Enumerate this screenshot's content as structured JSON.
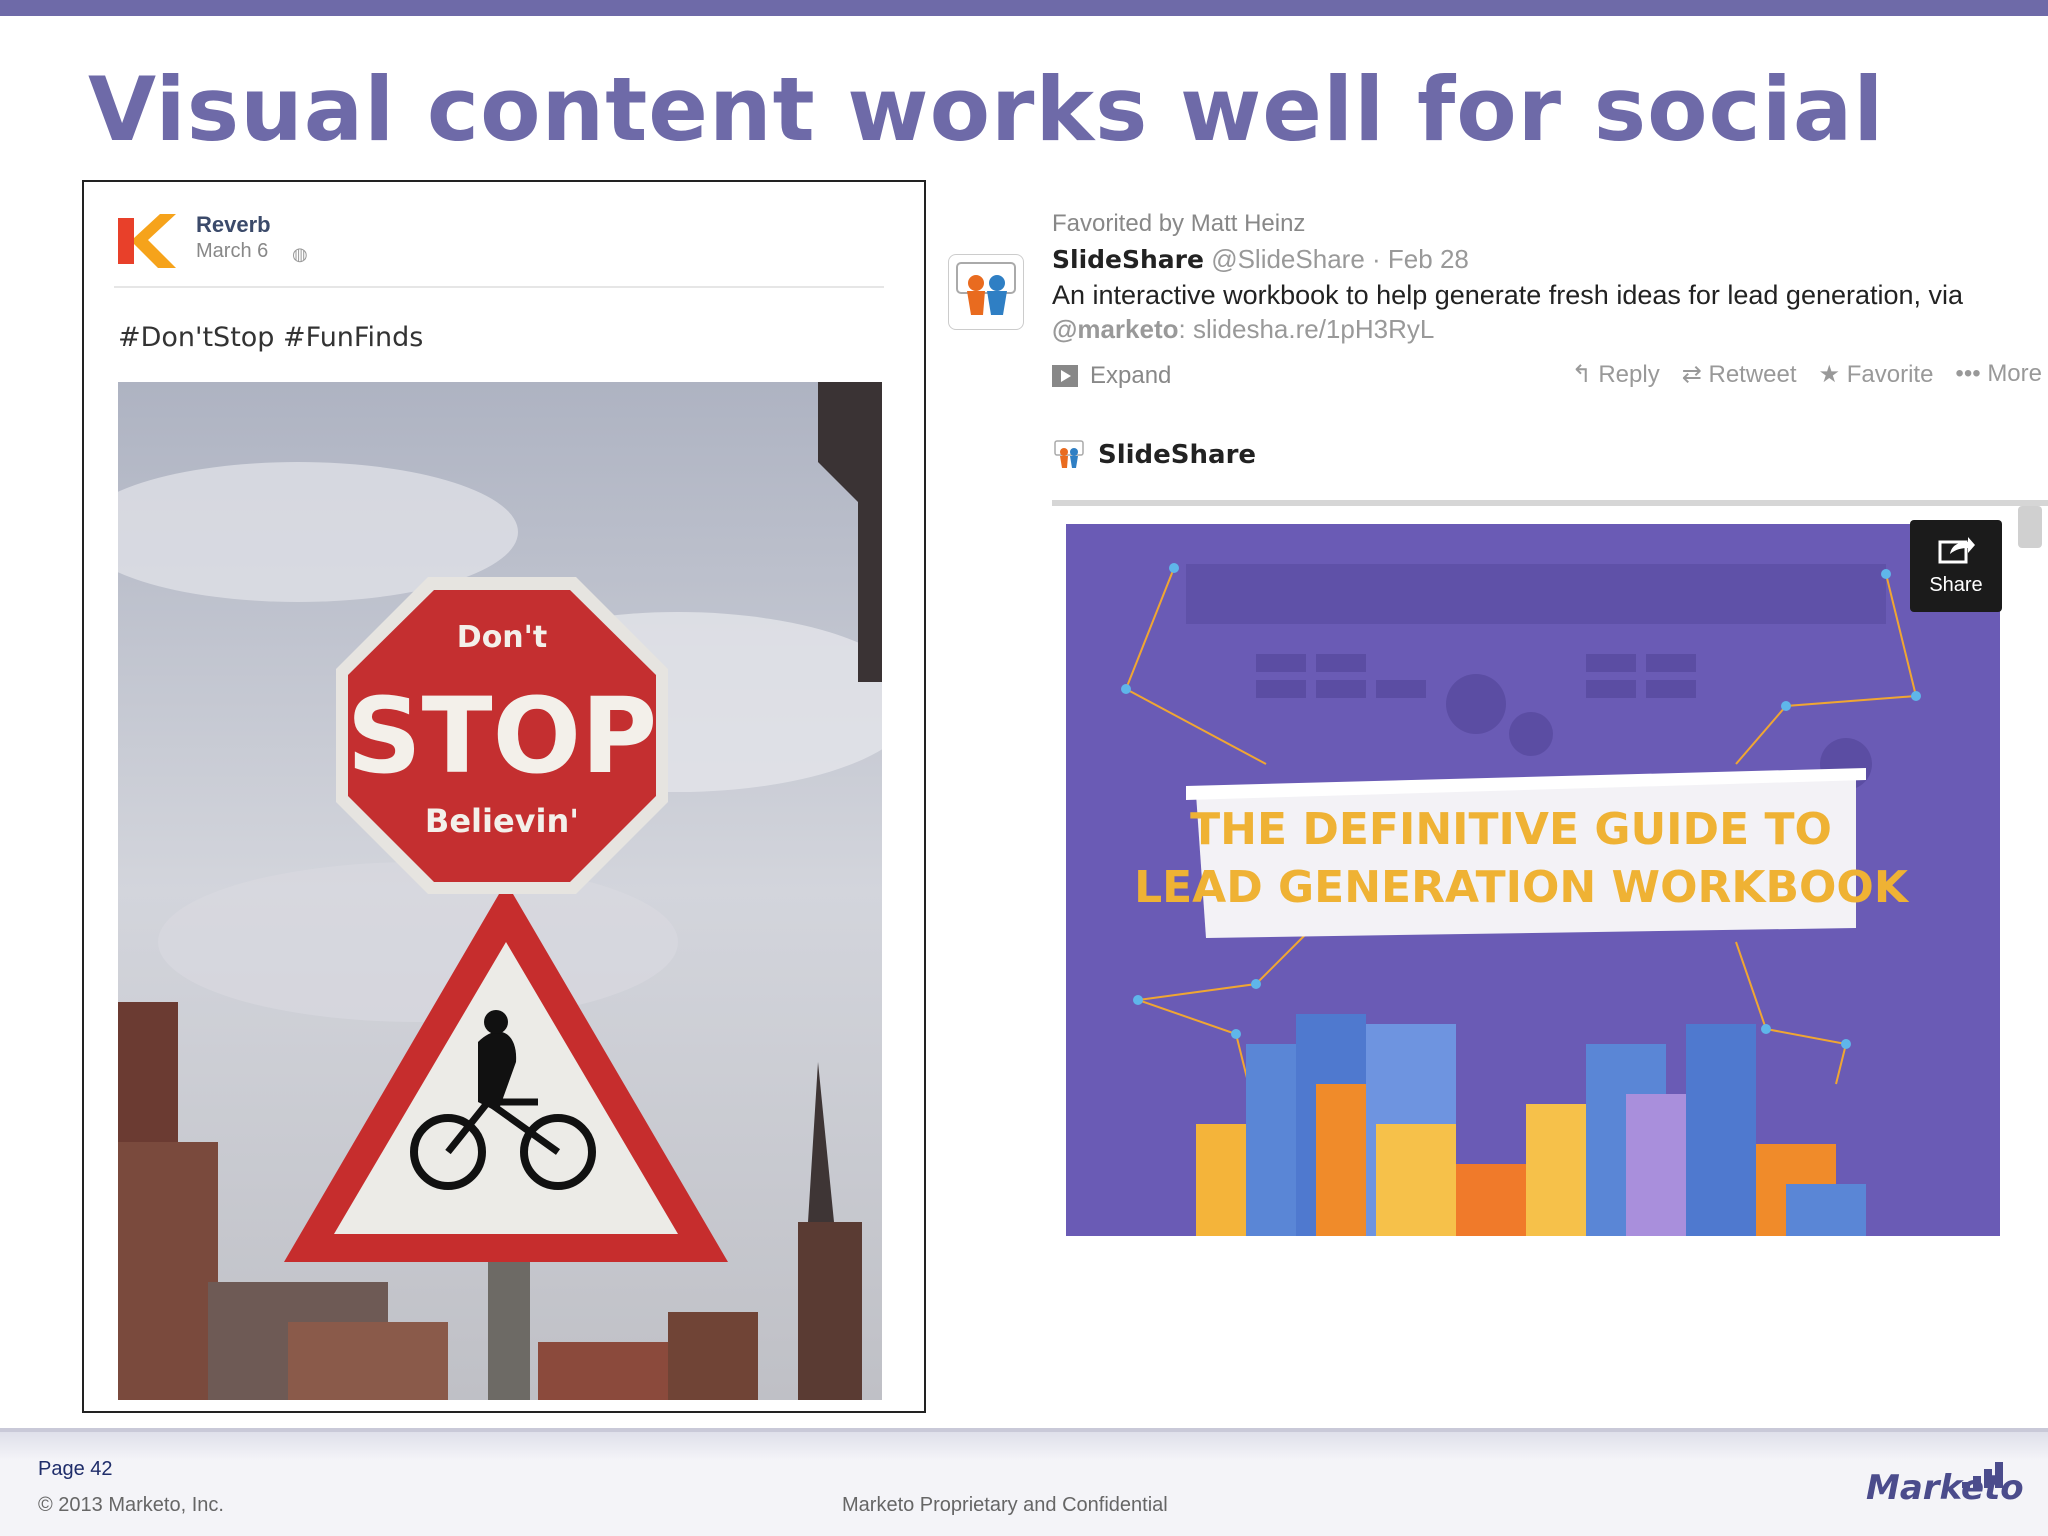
{
  "slide": {
    "title": "Visual content works well for social"
  },
  "facebook_post": {
    "page_name": "Reverb",
    "date": "March 6",
    "text": "#Don'tStop #FunFinds",
    "photo_sign_top": "Don't",
    "photo_sign_main": "STOP",
    "photo_sign_bottom": "Believin'"
  },
  "tweet": {
    "favorited_by": "Favorited by Matt Heinz",
    "author": "SlideShare",
    "handle": "@SlideShare",
    "date": "Feb 28",
    "text_line1": "An interactive workbook to help generate fresh ideas for lead generation, via",
    "mention": "@marketo",
    "link": "slidesha.re/1pH3RyL",
    "expand_label": "Expand",
    "actions": [
      "Reply",
      "Retweet",
      "Favorite",
      "More"
    ],
    "embed_brand": "SlideShare",
    "share_label": "Share",
    "embed_title_line1": "THE DEFINITIVE GUIDE TO",
    "embed_title_line2": "LEAD GENERATION WORKBOOK"
  },
  "footer": {
    "page": "Page 42",
    "copyright": "© 2013 Marketo, Inc.",
    "confidential": "Marketo Proprietary and Confidential",
    "logo": "Marketo"
  },
  "colors": {
    "title": "#6e6aa8",
    "embed_bg": "#6a5bb5",
    "fb_name": "#3b4a6a"
  }
}
